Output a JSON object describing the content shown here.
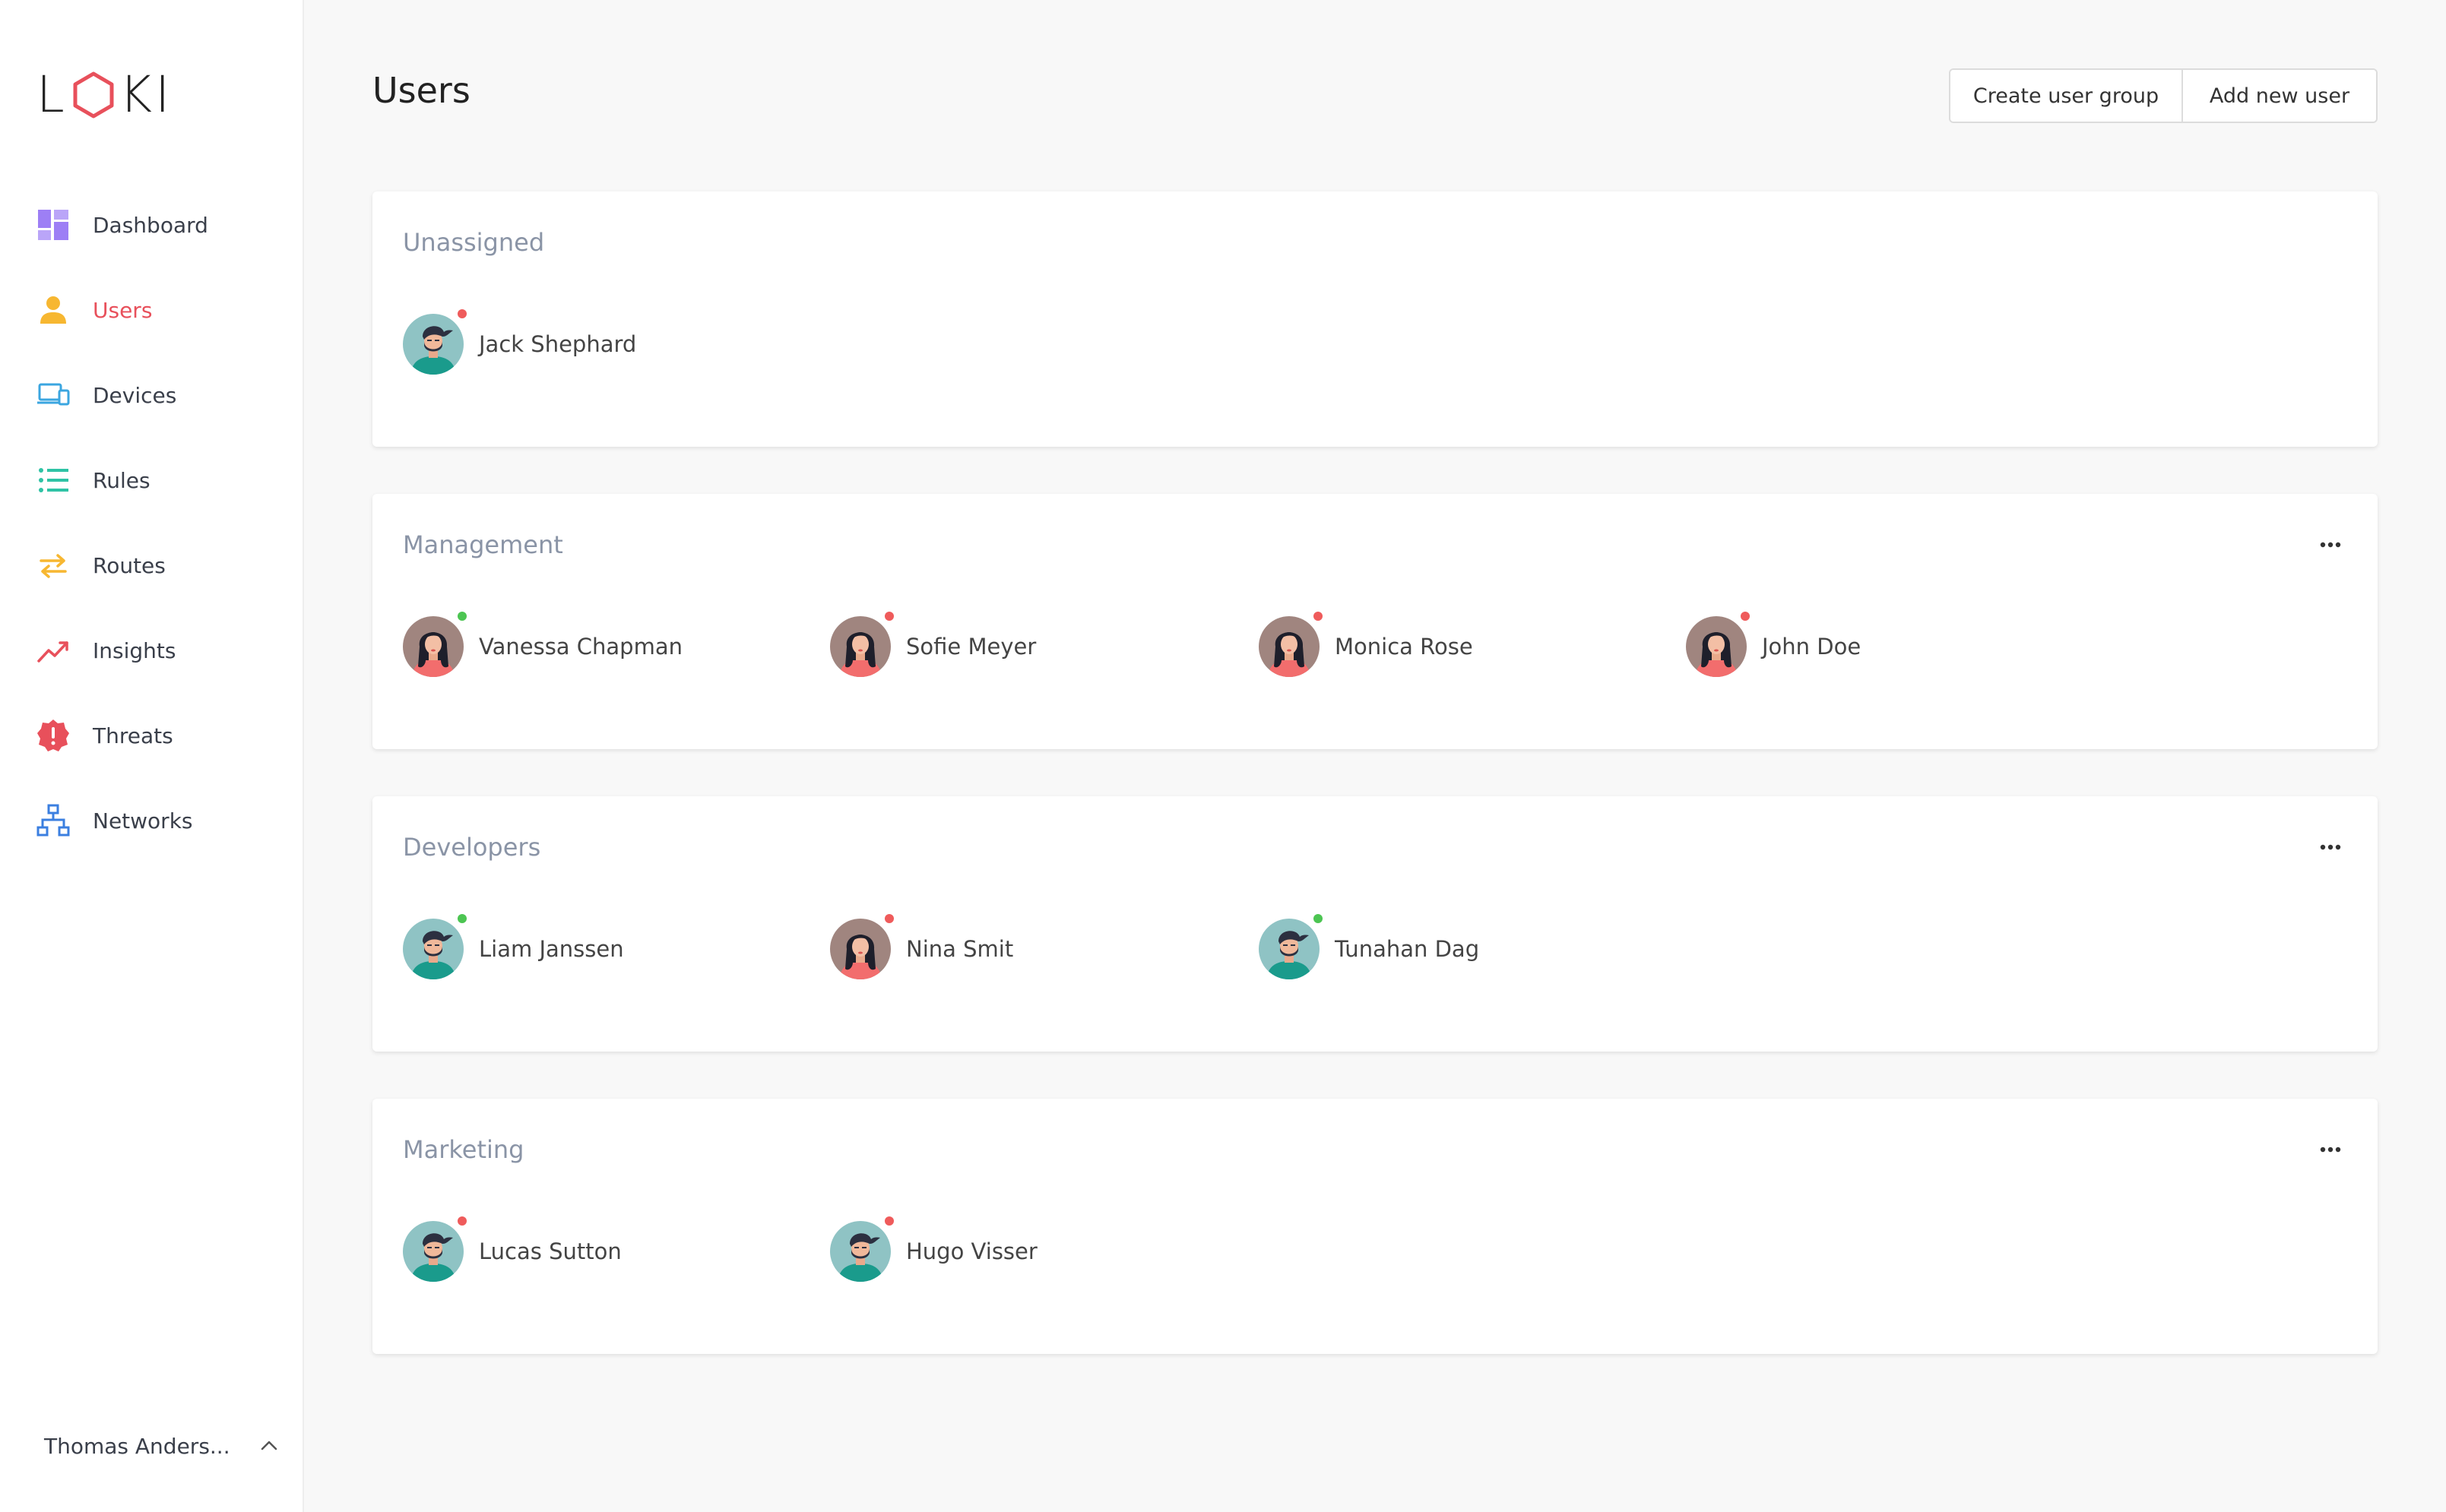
{
  "app": {
    "logo_text_left": "L",
    "logo_text_right": "KI",
    "page_title": "Users"
  },
  "colors": {
    "accent": "#e8505b",
    "online": "#4cc552",
    "offline": "#ef5b5b",
    "dashboard": "#9d7ff5",
    "users": "#f7b731",
    "devices": "#3ba6e0",
    "rules": "#2fc3a5",
    "routes": "#f7b731",
    "insights": "#e8505b",
    "threats": "#e8505b",
    "networks": "#3b7fe0"
  },
  "sidebar": {
    "items": [
      {
        "label": "Dashboard",
        "icon": "dashboard-icon",
        "active": false
      },
      {
        "label": "Users",
        "icon": "user-icon",
        "active": true
      },
      {
        "label": "Devices",
        "icon": "devices-icon",
        "active": false
      },
      {
        "label": "Rules",
        "icon": "list-icon",
        "active": false
      },
      {
        "label": "Routes",
        "icon": "arrows-swap-icon",
        "active": false
      },
      {
        "label": "Insights",
        "icon": "trend-icon",
        "active": false
      },
      {
        "label": "Threats",
        "icon": "alert-badge-icon",
        "active": false
      },
      {
        "label": "Networks",
        "icon": "network-icon",
        "active": false
      }
    ],
    "current_user": "Thomas Anders..."
  },
  "toolbar": {
    "create_group_label": "Create user group",
    "add_user_label": "Add new user"
  },
  "groups": [
    {
      "title": "Unassigned",
      "has_menu": false,
      "members": [
        {
          "name": "Jack Shephard",
          "avatar": "male",
          "status": "offline"
        }
      ]
    },
    {
      "title": "Management",
      "has_menu": true,
      "members": [
        {
          "name": "Vanessa Chapman",
          "avatar": "female",
          "status": "online"
        },
        {
          "name": "Sofie Meyer",
          "avatar": "female",
          "status": "offline"
        },
        {
          "name": "Monica Rose",
          "avatar": "female",
          "status": "offline"
        },
        {
          "name": "John Doe",
          "avatar": "female",
          "status": "offline"
        }
      ]
    },
    {
      "title": "Developers",
      "has_menu": true,
      "members": [
        {
          "name": "Liam Janssen",
          "avatar": "male",
          "status": "online"
        },
        {
          "name": "Nina Smit",
          "avatar": "female",
          "status": "offline"
        },
        {
          "name": "Tunahan Dag",
          "avatar": "male",
          "status": "online"
        }
      ]
    },
    {
      "title": "Marketing",
      "has_menu": true,
      "members": [
        {
          "name": "Lucas Sutton",
          "avatar": "male",
          "status": "offline"
        },
        {
          "name": "Hugo Visser",
          "avatar": "male",
          "status": "offline"
        }
      ]
    }
  ]
}
